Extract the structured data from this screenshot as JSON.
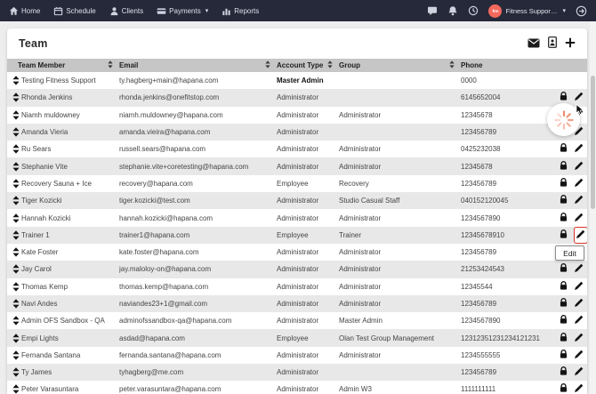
{
  "navbar": {
    "items": [
      {
        "label": "Home"
      },
      {
        "label": "Schedule"
      },
      {
        "label": "Clients"
      },
      {
        "label": "Payments",
        "has_caret": true
      },
      {
        "label": "Reports"
      }
    ],
    "user": {
      "initials": "ftm",
      "name": "Fitness Support...",
      "avatar_color": "#f2685c"
    }
  },
  "page": {
    "title": "Team"
  },
  "toolbar": {
    "icons": [
      "email-icon",
      "export-file-icon",
      "add-icon"
    ]
  },
  "table": {
    "columns": [
      {
        "label": "Team Member",
        "sortable": true
      },
      {
        "label": "Email",
        "sortable": true
      },
      {
        "label": "Account Type",
        "sortable": true
      },
      {
        "label": "Group",
        "sortable": true
      },
      {
        "label": "Phone",
        "sortable": false
      }
    ],
    "rows": [
      {
        "name": "Testing Fitness Support",
        "email": "ty.hagberg+main@hapana.com",
        "account_type": "Master Admin",
        "group": "",
        "phone": "0000",
        "account_bold": true,
        "actions": false,
        "pencil_highlight": false
      },
      {
        "name": "Rhonda Jenkins",
        "email": "rhonda.jenkins@onefitstop.com",
        "account_type": "Administrator",
        "group": "",
        "phone": "6145652004",
        "account_bold": false,
        "actions": true,
        "pencil_highlight": false
      },
      {
        "name": "Niamh muldowney",
        "email": "niamh.muldowney@hapana.com",
        "account_type": "Administrator",
        "group": "Administrator",
        "phone": "12345678",
        "account_bold": false,
        "actions": true,
        "pencil_highlight": false
      },
      {
        "name": "Amanda Vieria",
        "email": "amanda.vieira@hapana.com",
        "account_type": "Administrator",
        "group": "",
        "phone": "123456789",
        "account_bold": false,
        "actions": true,
        "pencil_highlight": false
      },
      {
        "name": "Ru Sears",
        "email": "russell.sears@hapana.com",
        "account_type": "Administrator",
        "group": "Administrator",
        "phone": "0425232038",
        "account_bold": false,
        "actions": true,
        "pencil_highlight": false
      },
      {
        "name": "Stephanie Vite",
        "email": "stephanie.vite+coretesting@hapana.com",
        "account_type": "Administrator",
        "group": "Administrator",
        "phone": "12345678",
        "account_bold": false,
        "actions": true,
        "pencil_highlight": false
      },
      {
        "name": "Recovery Sauna + Ice",
        "email": "recovery@hapana.com",
        "account_type": "Employee",
        "group": "Recovery",
        "phone": "123456789",
        "account_bold": false,
        "actions": true,
        "pencil_highlight": false
      },
      {
        "name": "Tiger Kozicki",
        "email": "tiger.kozicki@test.com",
        "account_type": "Administrator",
        "group": "Studio Casual Staff",
        "phone": "040152120045",
        "account_bold": false,
        "actions": true,
        "pencil_highlight": false
      },
      {
        "name": "Hannah Kozicki",
        "email": "hannah.kozicki@hapana.com",
        "account_type": "Administrator",
        "group": "Administrator",
        "phone": "1234567890",
        "account_bold": false,
        "actions": true,
        "pencil_highlight": false
      },
      {
        "name": "Trainer 1",
        "email": "trainer1@hapana.com",
        "account_type": "Employee",
        "group": "Trainer",
        "phone": "12345678910",
        "account_bold": false,
        "actions": true,
        "pencil_highlight": true
      },
      {
        "name": "Kate Foster",
        "email": "kate.foster@hapana.com",
        "account_type": "Administrator",
        "group": "Administrator",
        "phone": "123456789",
        "account_bold": false,
        "actions": true,
        "pencil_highlight": false
      },
      {
        "name": "Jay Carol",
        "email": "jay.maloloy-on@hapana.com",
        "account_type": "Administrator",
        "group": "Administrator",
        "phone": "21253424543",
        "account_bold": false,
        "actions": true,
        "pencil_highlight": false
      },
      {
        "name": "Thomas Kemp",
        "email": "thomas.kemp@hapana.com",
        "account_type": "Administrator",
        "group": "Administrator",
        "phone": "12345544",
        "account_bold": false,
        "actions": true,
        "pencil_highlight": false
      },
      {
        "name": "Navi Andes",
        "email": "naviandes23+1@gmail.com",
        "account_type": "Administrator",
        "group": "Administrator",
        "phone": "123456789",
        "account_bold": false,
        "actions": true,
        "pencil_highlight": false
      },
      {
        "name": "Admin OFS Sandbox - QA",
        "email": "adminofssandbox-qa@hapana.com",
        "account_type": "Administrator",
        "group": "Master Admin",
        "phone": "1234567890",
        "account_bold": false,
        "actions": true,
        "pencil_highlight": false
      },
      {
        "name": "Empi Lights",
        "email": "asdad@hapana.com",
        "account_type": "Employee",
        "group": "Olan Test Group Management",
        "phone": "12312351231234121231",
        "account_bold": false,
        "actions": true,
        "pencil_highlight": false
      },
      {
        "name": "Fernanda Santana",
        "email": "fernanda.santana@hapana.com",
        "account_type": "Administrator",
        "group": "Administrator",
        "phone": "1234555555",
        "account_bold": false,
        "actions": true,
        "pencil_highlight": false
      },
      {
        "name": "Ty James",
        "email": "tyhagberg@me.com",
        "account_type": "Administrator",
        "group": "",
        "phone": "123456789",
        "account_bold": false,
        "actions": true,
        "pencil_highlight": false
      },
      {
        "name": "Peter Varasuntara",
        "email": "peter.varasuntara@hapana.com",
        "account_type": "Administrator",
        "group": "Admin W3",
        "phone": "1111111111",
        "account_bold": false,
        "actions": true,
        "pencil_highlight": false
      }
    ]
  },
  "tooltip": {
    "label": "Edit"
  },
  "colors": {
    "navbar_bg": "#262939",
    "avatar_coral": "#f2685c",
    "table_header_bg": "#c6c6c6",
    "row_alt_bg": "#e8e8e8",
    "highlight_red": "#d8352a",
    "spinner_coral": "#ef8a70"
  }
}
